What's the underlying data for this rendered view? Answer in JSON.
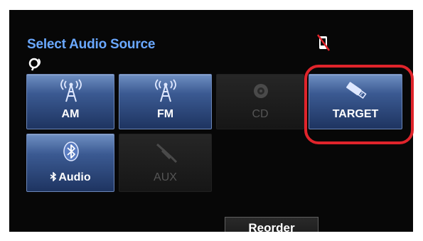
{
  "screen": {
    "title": "Select Audio Source",
    "status_icons": [
      "voice-command-icon",
      "phone-disconnected-icon"
    ],
    "highlight_color": "#e0242b",
    "accent_color": "#6aa8ff"
  },
  "sources": [
    {
      "label": "AM",
      "icon": "antenna-icon",
      "enabled": true
    },
    {
      "label": "FM",
      "icon": "antenna-icon",
      "enabled": true
    },
    {
      "label": "CD",
      "icon": "disc-icon",
      "enabled": false
    },
    {
      "label": "TARGET",
      "icon": "usb-icon",
      "enabled": true,
      "highlighted": true
    },
    {
      "label": "Audio",
      "icon": "bluetooth-icon",
      "enabled": true
    },
    {
      "label": "AUX",
      "icon": "aux-cable-icon",
      "enabled": false
    }
  ],
  "reorder_label": "Reorder"
}
